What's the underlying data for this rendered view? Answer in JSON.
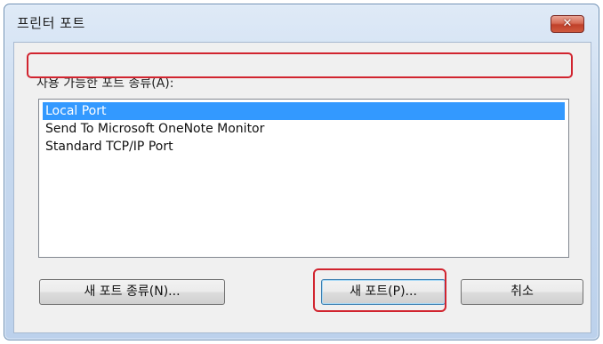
{
  "window": {
    "title": "프린터 포트",
    "close_symbol": "✕"
  },
  "dialog": {
    "list_label": "사용 가능한 포트 종류(A):",
    "port_types": [
      {
        "label": "Local Port",
        "selected": true
      },
      {
        "label": "Send To Microsoft OneNote Monitor",
        "selected": false
      },
      {
        "label": "Standard TCP/IP Port",
        "selected": false
      }
    ],
    "buttons": {
      "new_port_type": "새 포트 종류(N)...",
      "new_port": "새 포트(P)...",
      "cancel": "취소"
    }
  },
  "colors": {
    "selection": "#3399ff",
    "annotation_highlight": "#d1242f",
    "close_button": "#c0402a"
  },
  "icons": {
    "close": "close-icon"
  }
}
